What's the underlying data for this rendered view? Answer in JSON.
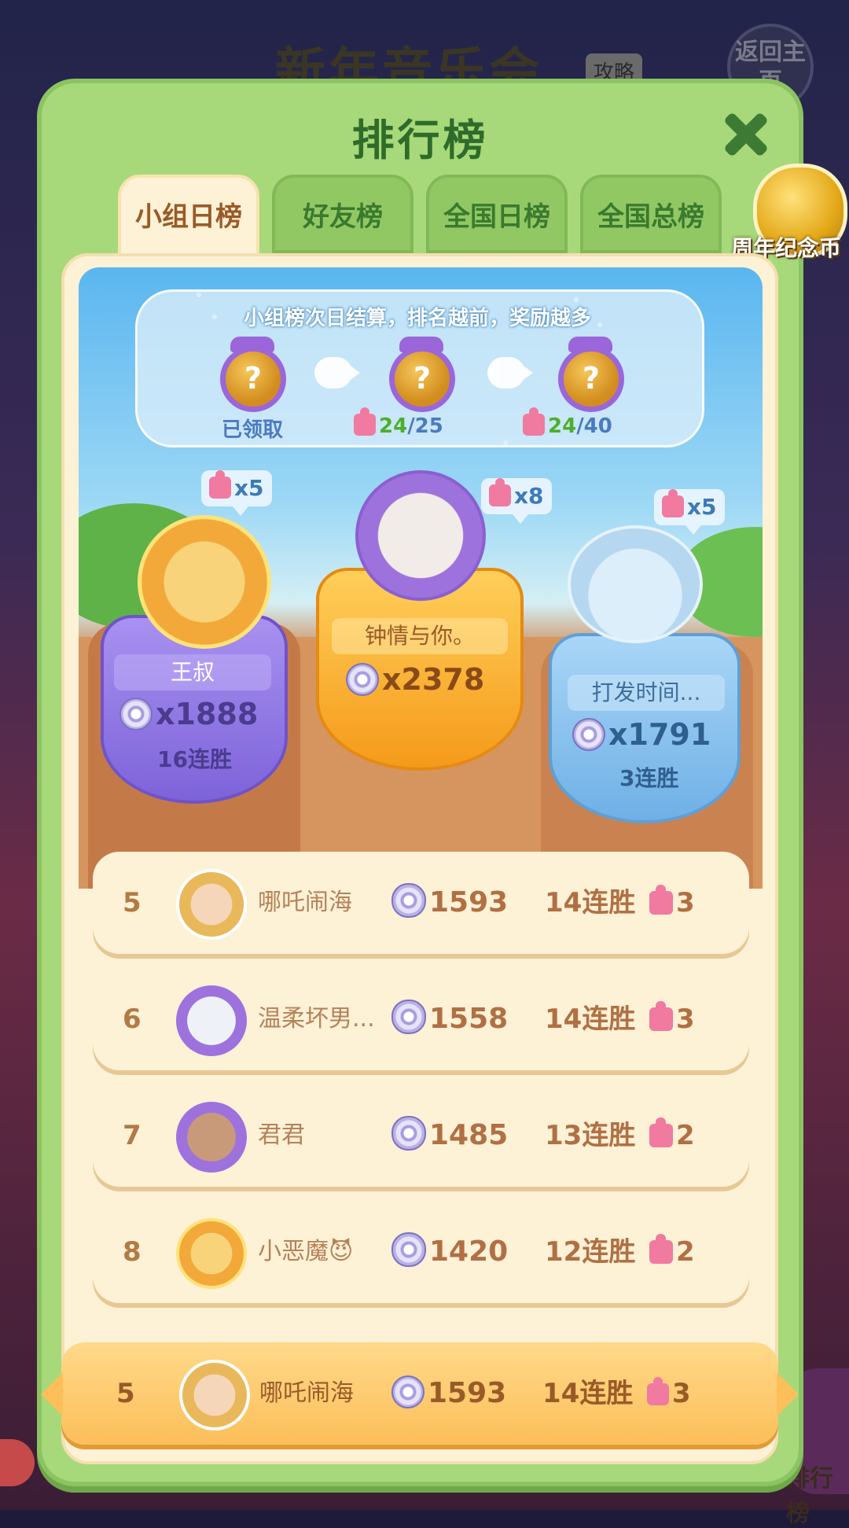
{
  "background": {
    "title": "新年音乐会",
    "tag": "攻略",
    "back_button": "返回主页",
    "bottom_right_label": "排行榜"
  },
  "panel": {
    "title": "排行榜"
  },
  "tabs": [
    {
      "label": "小组日榜",
      "active": true
    },
    {
      "label": "好友榜",
      "active": false
    },
    {
      "label": "全国日榜",
      "active": false
    },
    {
      "label": "全国总榜",
      "active": false
    }
  ],
  "side_badge": {
    "label": "周年纪念币",
    "icon": "coin-icon"
  },
  "reward_info": {
    "text": "小组榜次日结算，排名越前，奖励越多",
    "stages": [
      {
        "status": "已领取"
      },
      {
        "progress": "24",
        "target": "/25"
      },
      {
        "progress": "24",
        "target": "/40"
      }
    ]
  },
  "podium": {
    "first": {
      "name": "钟情与你。",
      "score": "x2378",
      "reward": "x8"
    },
    "second": {
      "name": "王叔",
      "score": "x1888",
      "streak": "16连胜",
      "reward": "x5"
    },
    "third": {
      "name": "打发时间...",
      "score": "x1791",
      "streak": "3连胜",
      "reward": "x5"
    }
  },
  "ranking_rows": [
    {
      "rank": "5",
      "name": "哪吒闹海",
      "score": "1593",
      "streak": "14连胜",
      "reward": "3"
    },
    {
      "rank": "6",
      "name": "温柔坏男...",
      "score": "1558",
      "streak": "14连胜",
      "reward": "3"
    },
    {
      "rank": "7",
      "name": "君君",
      "score": "1485",
      "streak": "13连胜",
      "reward": "2"
    },
    {
      "rank": "8",
      "name": "小恶魔😈",
      "score": "1420",
      "streak": "12连胜",
      "reward": "2"
    }
  ],
  "my_rank": {
    "rank": "5",
    "name": "哪吒闹海",
    "score": "1593",
    "streak": "14连胜",
    "reward": "3"
  },
  "colors": {
    "panel_green": "#a7d97a",
    "cream": "#fdf2d6",
    "gold": "#fcbf5a",
    "purple_shield": "#9b82ea",
    "blue_shield": "#8fc3f0",
    "orange_shield": "#fbb537"
  }
}
